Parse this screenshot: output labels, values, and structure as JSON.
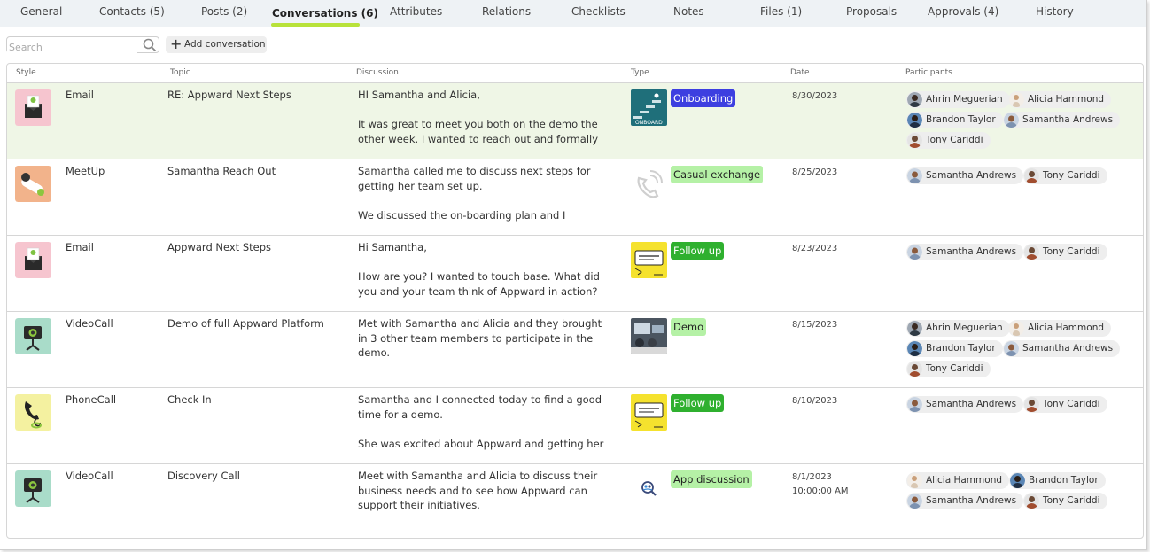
{
  "tabs": [
    {
      "label": "General"
    },
    {
      "label": "Contacts (5)"
    },
    {
      "label": "Posts (2)"
    },
    {
      "label": "Conversations (6)",
      "active": true
    },
    {
      "label": "Attributes"
    },
    {
      "label": "Relations"
    },
    {
      "label": "Checklists"
    },
    {
      "label": "Notes"
    },
    {
      "label": "Files (1)"
    },
    {
      "label": "Proposals"
    },
    {
      "label": "Approvals (4)"
    },
    {
      "label": "History"
    }
  ],
  "toolbar": {
    "search_placeholder": "Search",
    "add_label": "Add conversation"
  },
  "columns": {
    "style": "Style",
    "topic": "Topic",
    "discussion": "Discussion",
    "type": "Type",
    "date": "Date",
    "participants": "Participants"
  },
  "colors": {
    "accent_underline": "#b8e23a",
    "highlight_row": "#eff6e6",
    "tag_onboarding": "#3d3fe0",
    "tag_green": "#b5f1a6"
  },
  "rows": [
    {
      "style": "Email",
      "topic": "RE: Appward Next Steps",
      "discussion": "HI Samantha and Alicia,\n\nIt was great to meet you both on the demo the\nother week. I wanted to reach out and formally",
      "type": "Onboarding",
      "date": "8/30/2023",
      "date2": "",
      "participants": [
        "Ahrin Meguerian",
        "Alicia Hammond",
        "Brandon Taylor",
        "Samantha Andrews",
        "Tony Cariddi"
      ]
    },
    {
      "style": "MeetUp",
      "topic": "Samantha Reach Out",
      "discussion": "Samantha called me to discuss next steps for\ngetting her team set up.\n\nWe discussed the on-boarding plan and I",
      "type": "Casual exchange",
      "date": "8/25/2023",
      "date2": "",
      "participants": [
        "Samantha Andrews",
        "Tony Cariddi"
      ]
    },
    {
      "style": "Email",
      "topic": "Appward Next Steps",
      "discussion": "Hi Samantha,\n\nHow are you? I wanted to touch base. What did\nyou and your team think of Appward in action?",
      "type": "Follow up",
      "date": "8/23/2023",
      "date2": "",
      "participants": [
        "Samantha Andrews",
        "Tony Cariddi"
      ]
    },
    {
      "style": "VideoCall",
      "topic": "Demo of full Appward Platform",
      "discussion": "Met with Samantha and Alicia and they brought\nin 3 other team members to participate in the\ndemo.",
      "type": "Demo",
      "date": "8/15/2023",
      "date2": "",
      "participants": [
        "Ahrin Meguerian",
        "Alicia Hammond",
        "Brandon Taylor",
        "Samantha Andrews",
        "Tony Cariddi"
      ]
    },
    {
      "style": "PhoneCall",
      "topic": "Check In",
      "discussion": "Samantha and I connected today to find a good\ntime for a demo.\n\nShe was excited about Appward and getting her",
      "type": "Follow up",
      "date": "8/10/2023",
      "date2": "",
      "participants": [
        "Samantha Andrews",
        "Tony Cariddi"
      ]
    },
    {
      "style": "VideoCall",
      "topic": "Discovery Call",
      "discussion": "Meet with Samantha and Alicia to discuss their\nbusiness needs and to see how Appward can\nsupport their initiatives.",
      "type": "App discussion",
      "date": "8/1/2023",
      "date2": "10:00:00 AM",
      "participants": [
        "Alicia Hammond",
        "Brandon Taylor",
        "Samantha Andrews",
        "Tony Cariddi"
      ]
    }
  ]
}
